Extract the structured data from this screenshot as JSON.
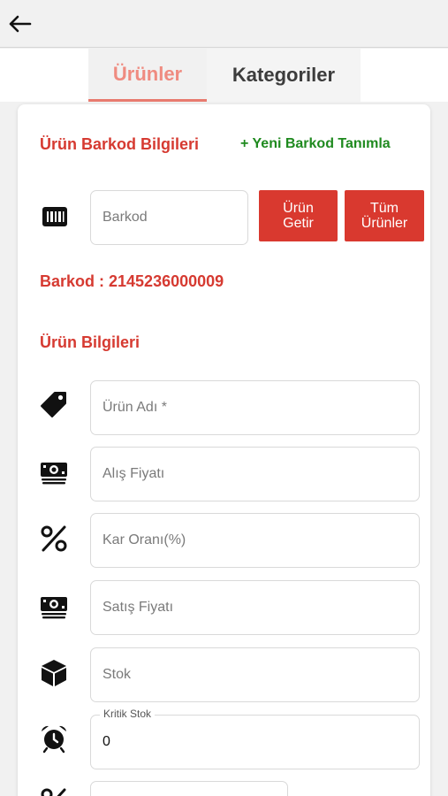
{
  "header": {
    "back_icon": "arrow-left-icon"
  },
  "tabs": [
    {
      "label": "Ürünler",
      "active": true
    },
    {
      "label": "Kategoriler",
      "active": false
    }
  ],
  "barcode_section": {
    "title": "Ürün Barkod Bilgileri",
    "new_barcode_link": "+ Yeni Barkod Tanımla",
    "barcode_placeholder": "Barkod",
    "fetch_button": "Ürün Getir",
    "all_products_button": "Tüm Ürünler",
    "barcode_display": "Barkod : 2145236000009"
  },
  "product_section": {
    "title": "Ürün Bilgileri",
    "fields": {
      "name": {
        "placeholder": "Ürün Adı *",
        "icon": "tag-icon"
      },
      "purchase_price": {
        "placeholder": "Alış Fiyatı",
        "icon": "money-icon"
      },
      "margin": {
        "placeholder": "Kar Oranı(%)",
        "icon": "percent-icon"
      },
      "sale_price": {
        "placeholder": "Satış Fiyatı",
        "icon": "money-icon"
      },
      "stock": {
        "placeholder": "Stok",
        "icon": "cube-icon"
      },
      "critical_stock": {
        "label": "Kritik Stok",
        "value": "0",
        "icon": "alarm-clock-icon"
      }
    }
  },
  "colors": {
    "accent_red": "#d9392f",
    "link_green": "#1f8a1f",
    "active_tab": "#ef8b80"
  }
}
